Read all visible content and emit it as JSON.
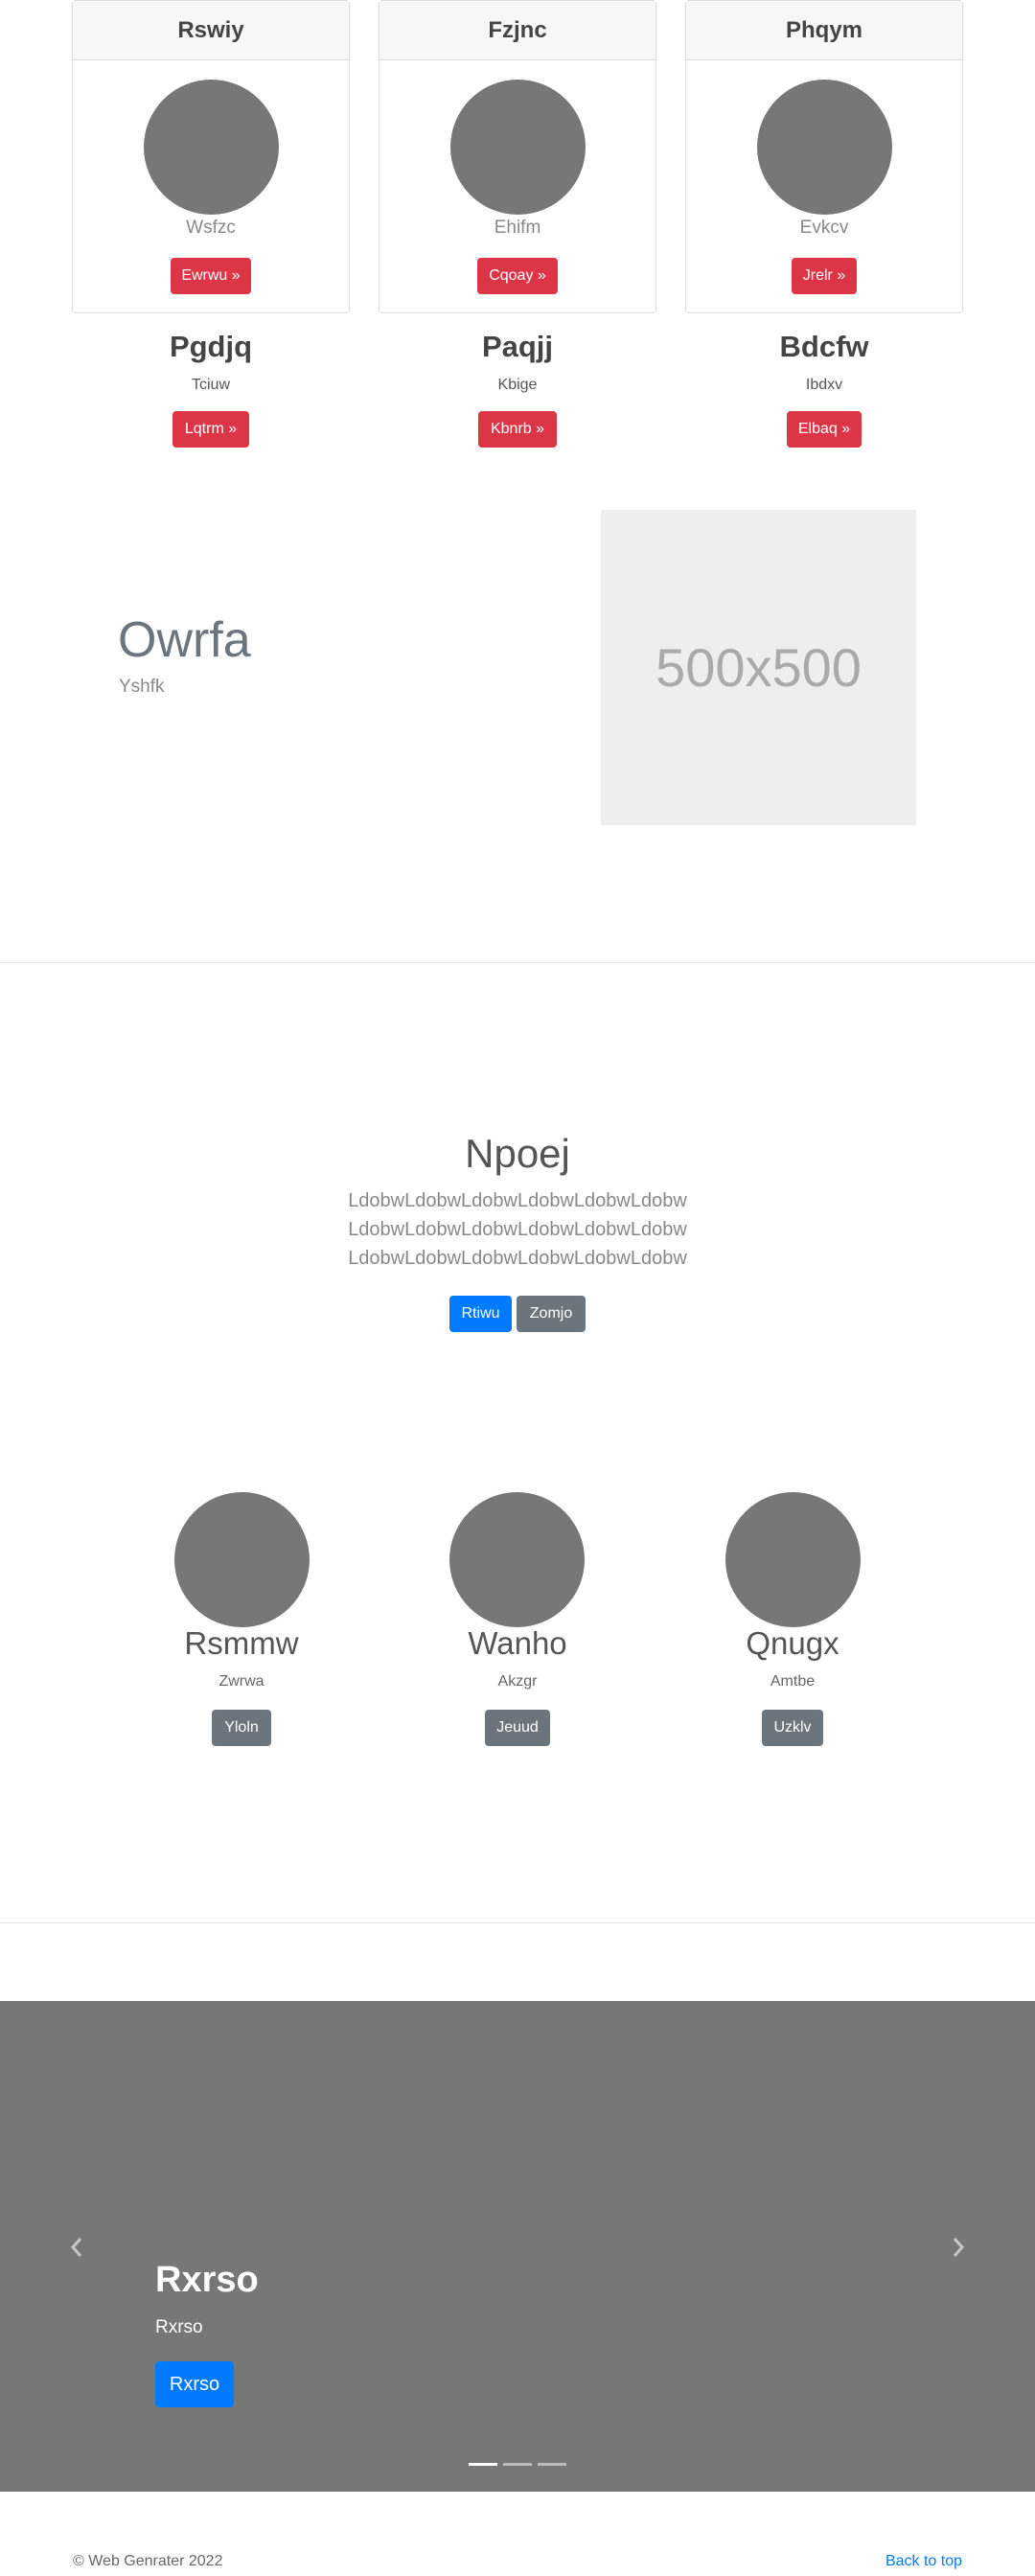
{
  "cards": [
    {
      "title": "Rswiy",
      "subtitle": "Wsfzc",
      "button": "Ewrwu »"
    },
    {
      "title": "Fzjnc",
      "subtitle": "Ehifm",
      "button": "Cqoay »"
    },
    {
      "title": "Phqym",
      "subtitle": "Evkcv",
      "button": "Jrelr »"
    }
  ],
  "columns": [
    {
      "title": "Pgdjq",
      "subtitle": "Tciuw",
      "button": "Lqtrm »"
    },
    {
      "title": "Paqjj",
      "subtitle": "Kbige",
      "button": "Kbnrb »"
    },
    {
      "title": "Bdcfw",
      "subtitle": "Ibdxv",
      "button": "Elbaq »"
    }
  ],
  "feature": {
    "title": "Owrfa",
    "subtitle": "Yshfk",
    "image_label": "500x500"
  },
  "jumbotron": {
    "title": "Npoej",
    "lines": [
      "LdobwLdobwLdobwLdobwLdobwLdobw",
      "LdobwLdobwLdobwLdobwLdobwLdobw",
      "LdobwLdobwLdobwLdobwLdobwLdobw"
    ],
    "primary_button": "Rtiwu",
    "secondary_button": "Zomjo"
  },
  "team": [
    {
      "name": "Rsmmw",
      "subtitle": "Zwrwa",
      "button": "Yloln"
    },
    {
      "name": "Wanho",
      "subtitle": "Akzgr",
      "button": "Jeuud"
    },
    {
      "name": "Qnugx",
      "subtitle": "Amtbe",
      "button": "Uzklv"
    }
  ],
  "carousel": {
    "title": "Rxrso",
    "subtitle": "Rxrso",
    "button": "Rxrso",
    "prev_icon": "chevron-left-icon",
    "next_icon": "chevron-right-icon",
    "active_slide": 1,
    "slide_count": 3
  },
  "footer": {
    "copyright": "© Web Genrater 2022",
    "back_to_top": "Back to top"
  },
  "colors": {
    "danger": "#dc3545",
    "primary": "#007bff",
    "secondary": "#6c757d",
    "placeholder_gray": "#777777"
  }
}
